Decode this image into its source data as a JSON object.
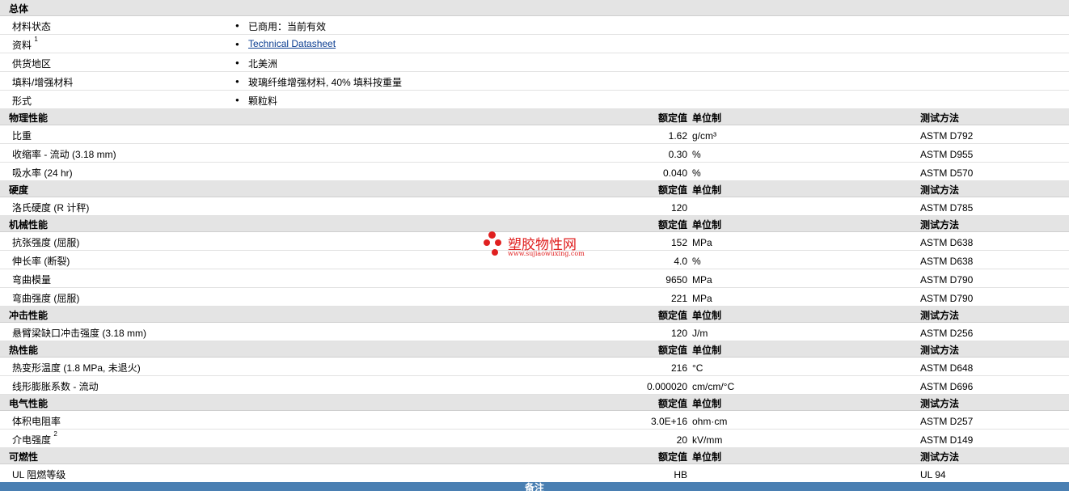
{
  "general": {
    "title": "总体",
    "rows": [
      {
        "label": "材料状态",
        "value": "已商用：当前有效"
      },
      {
        "label": "资料",
        "sup": "1",
        "value": "Technical Datasheet"
      },
      {
        "label": "供货地区",
        "value": "北美洲"
      },
      {
        "label": "填料/增强材料",
        "value": "玻璃纤维增强材料, 40% 填料按重量"
      },
      {
        "label": "形式",
        "value": "颗粒料"
      }
    ]
  },
  "columns": {
    "value": "额定值",
    "unit": "单位制",
    "method": "测试方法"
  },
  "sections": [
    {
      "title": "物理性能",
      "rows": [
        {
          "label": "比重",
          "value": "1.62",
          "unit": "g/cm³",
          "method": "ASTM D792"
        },
        {
          "label": "收缩率 - 流动 (3.18 mm)",
          "value": "0.30",
          "unit": "%",
          "method": "ASTM D955"
        },
        {
          "label": "吸水率 (24 hr)",
          "value": "0.040",
          "unit": "%",
          "method": "ASTM D570"
        }
      ]
    },
    {
      "title": "硬度",
      "rows": [
        {
          "label": "洛氏硬度 (R 计秤)",
          "value": "120",
          "unit": "",
          "method": "ASTM D785"
        }
      ]
    },
    {
      "title": "机械性能",
      "rows": [
        {
          "label": "抗张强度 (屈服)",
          "value": "152",
          "unit": "MPa",
          "method": "ASTM D638"
        },
        {
          "label": "伸长率 (断裂)",
          "value": "4.0",
          "unit": "%",
          "method": "ASTM D638"
        },
        {
          "label": "弯曲模量",
          "value": "9650",
          "unit": "MPa",
          "method": "ASTM D790"
        },
        {
          "label": "弯曲强度 (屈服)",
          "value": "221",
          "unit": "MPa",
          "method": "ASTM D790"
        }
      ]
    },
    {
      "title": "冲击性能",
      "rows": [
        {
          "label": "悬臂梁缺口冲击强度 (3.18 mm)",
          "value": "120",
          "unit": "J/m",
          "method": "ASTM D256"
        }
      ]
    },
    {
      "title": "热性能",
      "rows": [
        {
          "label": "热变形温度 (1.8 MPa, 未退火)",
          "value": "216",
          "unit": "°C",
          "method": "ASTM D648"
        },
        {
          "label": "线形膨胀系数 - 流动",
          "value": "0.000020",
          "unit": "cm/cm/°C",
          "method": "ASTM D696"
        }
      ]
    },
    {
      "title": "电气性能",
      "rows": [
        {
          "label": "体积电阻率",
          "value": "3.0E+16",
          "unit": "ohm·cm",
          "method": "ASTM D257"
        },
        {
          "label": "介电强度",
          "sup": "2",
          "value": "20",
          "unit": "kV/mm",
          "method": "ASTM D149"
        }
      ]
    },
    {
      "title": "可燃性",
      "rows": [
        {
          "label": "UL 阻燃等级",
          "value": "HB",
          "unit": "",
          "method": "UL 94"
        }
      ]
    }
  ],
  "footer": {
    "label": "备注"
  },
  "watermark": {
    "name": "塑胶物性网",
    "url": "www.sujiaowuxing.com"
  }
}
